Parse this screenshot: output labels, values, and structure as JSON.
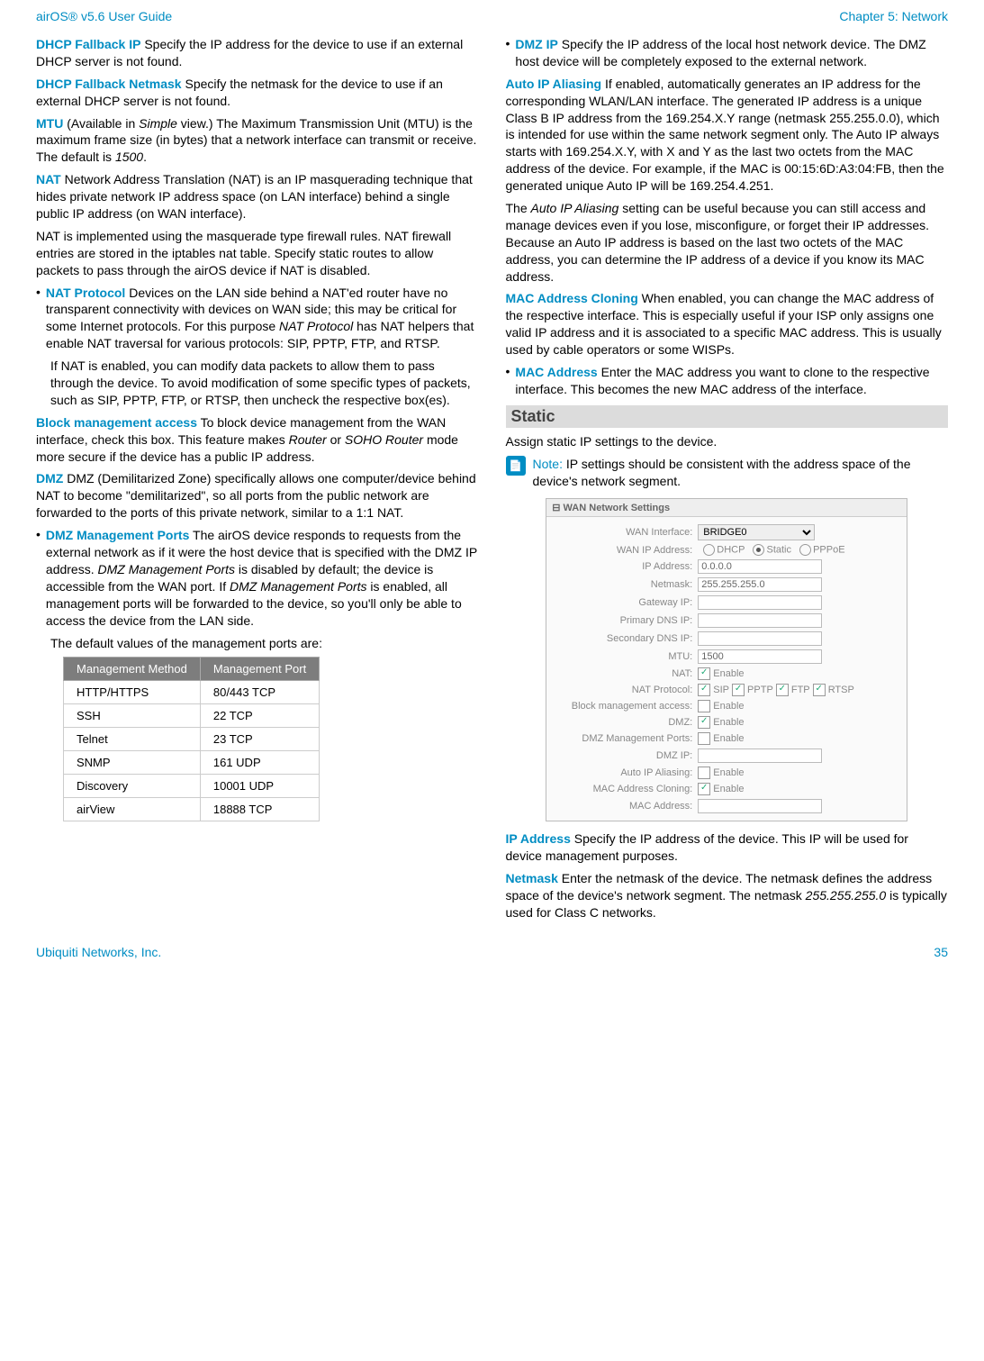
{
  "header": {
    "left": "airOS® v5.6 User Guide",
    "right": "Chapter 5: Network"
  },
  "footer": {
    "left": "Ubiquiti Networks, Inc.",
    "right": "35"
  },
  "left_col": {
    "dhcp_fallback_ip": {
      "term": "DHCP Fallback IP",
      "text": "  Specify the IP address for the device to use if an external DHCP server is not found."
    },
    "dhcp_fallback_netmask": {
      "term": "DHCP Fallback Netmask",
      "text": "  Specify the netmask for the device to use if an external DHCP server is not found."
    },
    "mtu": {
      "term": "MTU",
      "pre": "  (Available in ",
      "italic1": "Simple",
      "mid": " view.) The Maximum Transmission Unit (MTU) is the maximum frame size (in bytes) that a network interface can transmit or receive. The default is ",
      "italic2": "1500",
      "post": "."
    },
    "nat_top": {
      "term": "NAT",
      "text": "  Network Address Translation (NAT) is an IP masquerading technique that hides private network IP address space (on LAN interface) behind a single public IP address (on WAN interface)."
    },
    "nat_para": "NAT is implemented using the masquerade type firewall rules. NAT firewall entries are stored in the iptables nat table. Specify static routes to allow packets to pass through the airOS device if NAT is disabled.",
    "nat_protocol": {
      "term": "NAT Protocol",
      "text": "  Devices on the LAN side behind a NAT'ed router have no transparent connectivity with devices on WAN side; this may be critical for some Internet protocols. For this purpose ",
      "italic": "NAT Protocol",
      "post": " has NAT helpers that enable NAT traversal for various protocols: SIP, PPTP, FTP, and RTSP."
    },
    "nat_note": "If NAT is enabled, you can modify data packets to allow them to pass through the device. To avoid modification of some specific types of packets, such as SIP, PPTP, FTP, or RTSP, then uncheck the respective box(es).",
    "block_mgmt": {
      "term": "Block management access",
      "pre": "  To block device management from the WAN interface, check this box. This feature makes ",
      "italic1": "Router",
      "mid": " or ",
      "italic2": "SOHO Router",
      "post": " mode more secure if the device has a public IP address."
    },
    "dmz": {
      "term": "DMZ",
      "text": "  DMZ (Demilitarized Zone) specifically allows one computer/device behind NAT to become \"demilitarized\", so all ports from the public network are forwarded to the ports of this private network, similar to a 1:1 NAT."
    },
    "dmz_ports": {
      "term": "DMZ Management Ports",
      "pre": "  The airOS device responds to requests from the external network as if it were the host device that is specified with the DMZ IP address. ",
      "italic1": "DMZ Management Ports",
      "mid": " is disabled by default; the device is accessible from the WAN port. If ",
      "italic2": "DMZ Management Ports",
      "post": " is enabled, all management ports will be forwarded to the device, so you'll only be able to access the device from the LAN side."
    },
    "dmz_default": "The default values of the management ports are:",
    "table": {
      "headers": [
        "Management Method",
        "Management Port"
      ],
      "rows": [
        [
          "HTTP/HTTPS",
          "80/443 TCP"
        ],
        [
          "SSH",
          "22 TCP"
        ],
        [
          "Telnet",
          "23 TCP"
        ],
        [
          "SNMP",
          "161 UDP"
        ],
        [
          "Discovery",
          "10001 UDP"
        ],
        [
          "airView",
          "18888 TCP"
        ]
      ]
    }
  },
  "right_col": {
    "dmz_ip": {
      "term": "DMZ IP",
      "text": "  Specify the IP address of the local host network device. The DMZ host device will be completely exposed to the external network."
    },
    "auto_ip": {
      "term": "Auto IP Aliasing",
      "text": "  If enabled, automatically generates an IP address for the corresponding WLAN/LAN interface. The generated IP address is a unique Class B IP address from the 169.254.X.Y range (netmask 255.255.0.0), which is intended for use within the same network segment only. The Auto IP always starts with 169.254.X.Y, with X and Y as the last two octets from the MAC address of the device. For example, if the MAC is 00:15:6D:A3:04:FB, then the generated unique Auto IP will be 169.254.4.251."
    },
    "auto_ip_2": {
      "pre": "The ",
      "italic": "Auto IP Aliasing",
      "post": " setting can be useful because you can still access and manage devices even if you lose, misconfigure, or forget their IP addresses. Because an Auto IP address is based on the last two octets of the MAC address, you can determine the IP address of a device if you know its MAC address."
    },
    "mac_clone": {
      "term": "MAC Address Cloning",
      "text": "  When enabled, you can change the MAC address of the respective interface. This is especially useful if your ISP only assigns one valid IP address and it is associated to a specific MAC address. This is usually used by cable operators or some WISPs."
    },
    "mac_addr": {
      "term": "MAC Address",
      "text": "  Enter the MAC address you want to clone to the respective interface. This becomes the new MAC address of the interface."
    },
    "static_head": "Static",
    "static_para": "Assign static IP settings to the device.",
    "note": {
      "label": "Note:",
      "text": " IP settings should be consistent with the address space of the device's network segment."
    },
    "screenshot": {
      "title": "WAN Network Settings",
      "wan_interface_label": "WAN Interface:",
      "wan_interface_val": "BRIDGE0",
      "wan_ip_label": "WAN IP Address:",
      "dhcp": "DHCP",
      "static": "Static",
      "pppoe": "PPPoE",
      "ip_addr_label": "IP Address:",
      "ip_addr_val": "0.0.0.0",
      "netmask_label": "Netmask:",
      "netmask_val": "255.255.255.0",
      "gateway_label": "Gateway IP:",
      "primary_dns_label": "Primary DNS IP:",
      "secondary_dns_label": "Secondary DNS IP:",
      "mtu_label": "MTU:",
      "mtu_val": "1500",
      "nat_label": "NAT:",
      "enable": "Enable",
      "nat_proto_label": "NAT Protocol:",
      "sip": "SIP",
      "pptp": "PPTP",
      "ftp": "FTP",
      "rtsp": "RTSP",
      "block_label": "Block management access:",
      "dmz_label": "DMZ:",
      "dmz_ports_label": "DMZ Management Ports:",
      "dmz_ip_label": "DMZ IP:",
      "auto_alias_label": "Auto IP Aliasing:",
      "mac_clone_label": "MAC Address Cloning:",
      "mac_addr_label": "MAC Address:"
    },
    "ip_address": {
      "term": "IP Address",
      "text": "  Specify the IP address of the device. This IP will be used for device management purposes."
    },
    "netmask": {
      "term": "Netmask",
      "pre": "  Enter the netmask of the device. The netmask defines the address space of the device's network segment. The netmask ",
      "italic": "255.255.255.0",
      "post": " is typically used for Class C networks."
    }
  }
}
